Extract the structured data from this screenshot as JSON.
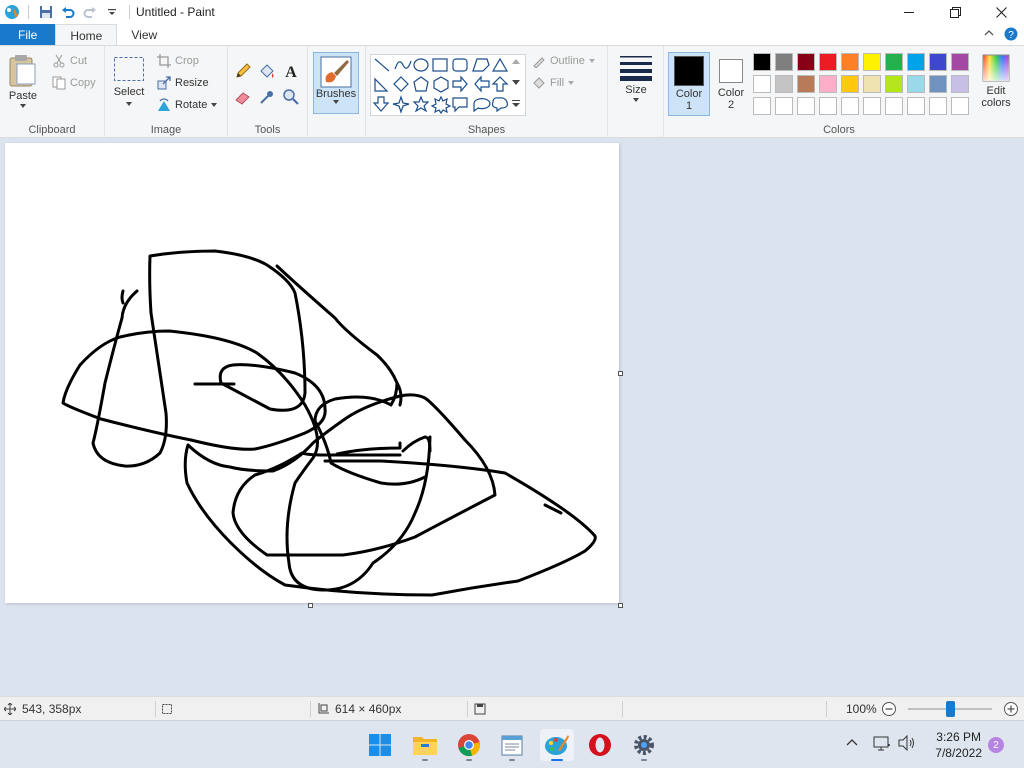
{
  "window": {
    "title": "Untitled - Paint"
  },
  "tabs": {
    "file": "File",
    "home": "Home",
    "view": "View"
  },
  "ribbon": {
    "clipboard": {
      "paste": "Paste",
      "cut": "Cut",
      "copy": "Copy",
      "label": "Clipboard"
    },
    "image": {
      "select": "Select",
      "crop": "Crop",
      "resize": "Resize",
      "rotate": "Rotate",
      "label": "Image"
    },
    "tools": {
      "label": "Tools"
    },
    "brushes": {
      "label": "Brushes"
    },
    "shapes": {
      "outline": "Outline",
      "fill": "Fill",
      "label": "Shapes"
    },
    "size": {
      "label": "Size"
    },
    "color1": {
      "line1": "Color",
      "line2": "1",
      "value": "#000000"
    },
    "color2": {
      "line1": "Color",
      "line2": "2",
      "value": "#ffffff"
    },
    "colors": {
      "label": "Colors",
      "edit_line1": "Edit",
      "edit_line2": "colors",
      "row1": [
        "#000000",
        "#7f7f7f",
        "#880015",
        "#ed1c24",
        "#ff7f27",
        "#fff200",
        "#22b14c",
        "#00a2e8",
        "#3f48cc",
        "#a349a4"
      ],
      "row2": [
        "#ffffff",
        "#c3c3c3",
        "#b97a57",
        "#ffaec9",
        "#ffc90e",
        "#efe4b0",
        "#b5e61d",
        "#99d9ea",
        "#7092be",
        "#c8bfe7"
      ],
      "row3": [
        "#ffffff",
        "#ffffff",
        "#ffffff",
        "#ffffff",
        "#ffffff",
        "#ffffff",
        "#ffffff",
        "#ffffff",
        "#ffffff",
        "#ffffff"
      ]
    }
  },
  "status": {
    "cursor_pos": "543, 358px",
    "canvas_size": "614 × 460px",
    "zoom": "100%",
    "zoom_level": 0.5
  },
  "taskbar": {
    "time": "3:26 PM",
    "date": "7/8/2022",
    "notifications": "2",
    "apps": [
      "start",
      "file-explorer",
      "chrome",
      "notepad",
      "paint",
      "opera",
      "settings"
    ]
  }
}
